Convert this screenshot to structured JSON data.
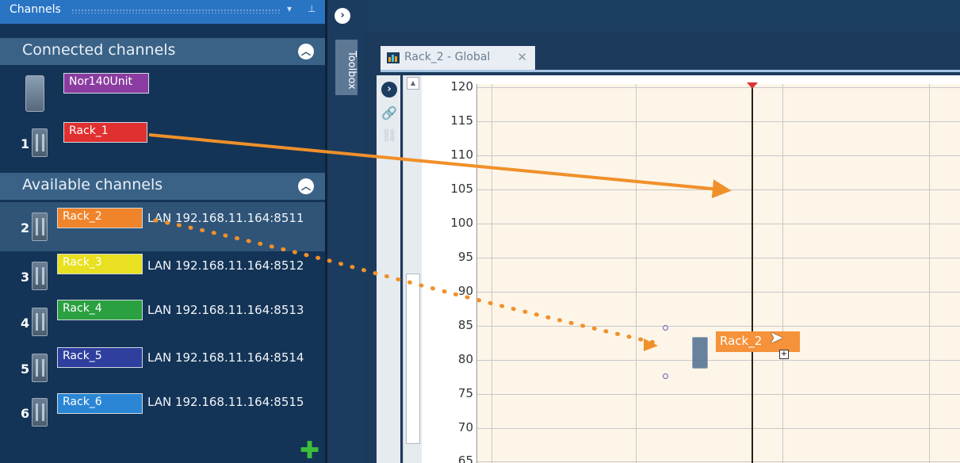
{
  "panel": {
    "title": "Channels",
    "pin_icon": "pin-icon",
    "dropdown_icon": "chevron-down-icon"
  },
  "connected": {
    "header": "Connected channels",
    "unit": {
      "label": "Nor140Unit",
      "color": "#8a3ca0"
    },
    "channels": [
      {
        "num": "1",
        "label": "Rack_1",
        "color": "#e03030"
      }
    ]
  },
  "available": {
    "header": "Available channels",
    "channels": [
      {
        "num": "2",
        "label": "Rack_2",
        "color": "#f0842a",
        "lan": "LAN 192.168.11.164:8511"
      },
      {
        "num": "3",
        "label": "Rack_3",
        "color": "#e8e020",
        "lan": "LAN 192.168.11.164:8512"
      },
      {
        "num": "4",
        "label": "Rack_4",
        "color": "#2aa040",
        "lan": "LAN 192.168.11.164:8513"
      },
      {
        "num": "5",
        "label": "Rack_5",
        "color": "#2e3f9e",
        "lan": "LAN 192.168.11.164:8514"
      },
      {
        "num": "6",
        "label": "Rack_6",
        "color": "#2a86d4",
        "lan": "LAN 192.168.11.164:8515"
      }
    ]
  },
  "toolbox": {
    "label": "Toolbox"
  },
  "document": {
    "tab_label": "Rack_2 - Global",
    "close_glyph": "✕",
    "y_ticks": [
      "120",
      "115",
      "110",
      "105",
      "100",
      "95",
      "90",
      "85",
      "80",
      "75",
      "70",
      "65"
    ],
    "drag_label": "Rack_2"
  },
  "colors": {
    "arrow": "#f0902a",
    "accent": "#2a74c4"
  }
}
